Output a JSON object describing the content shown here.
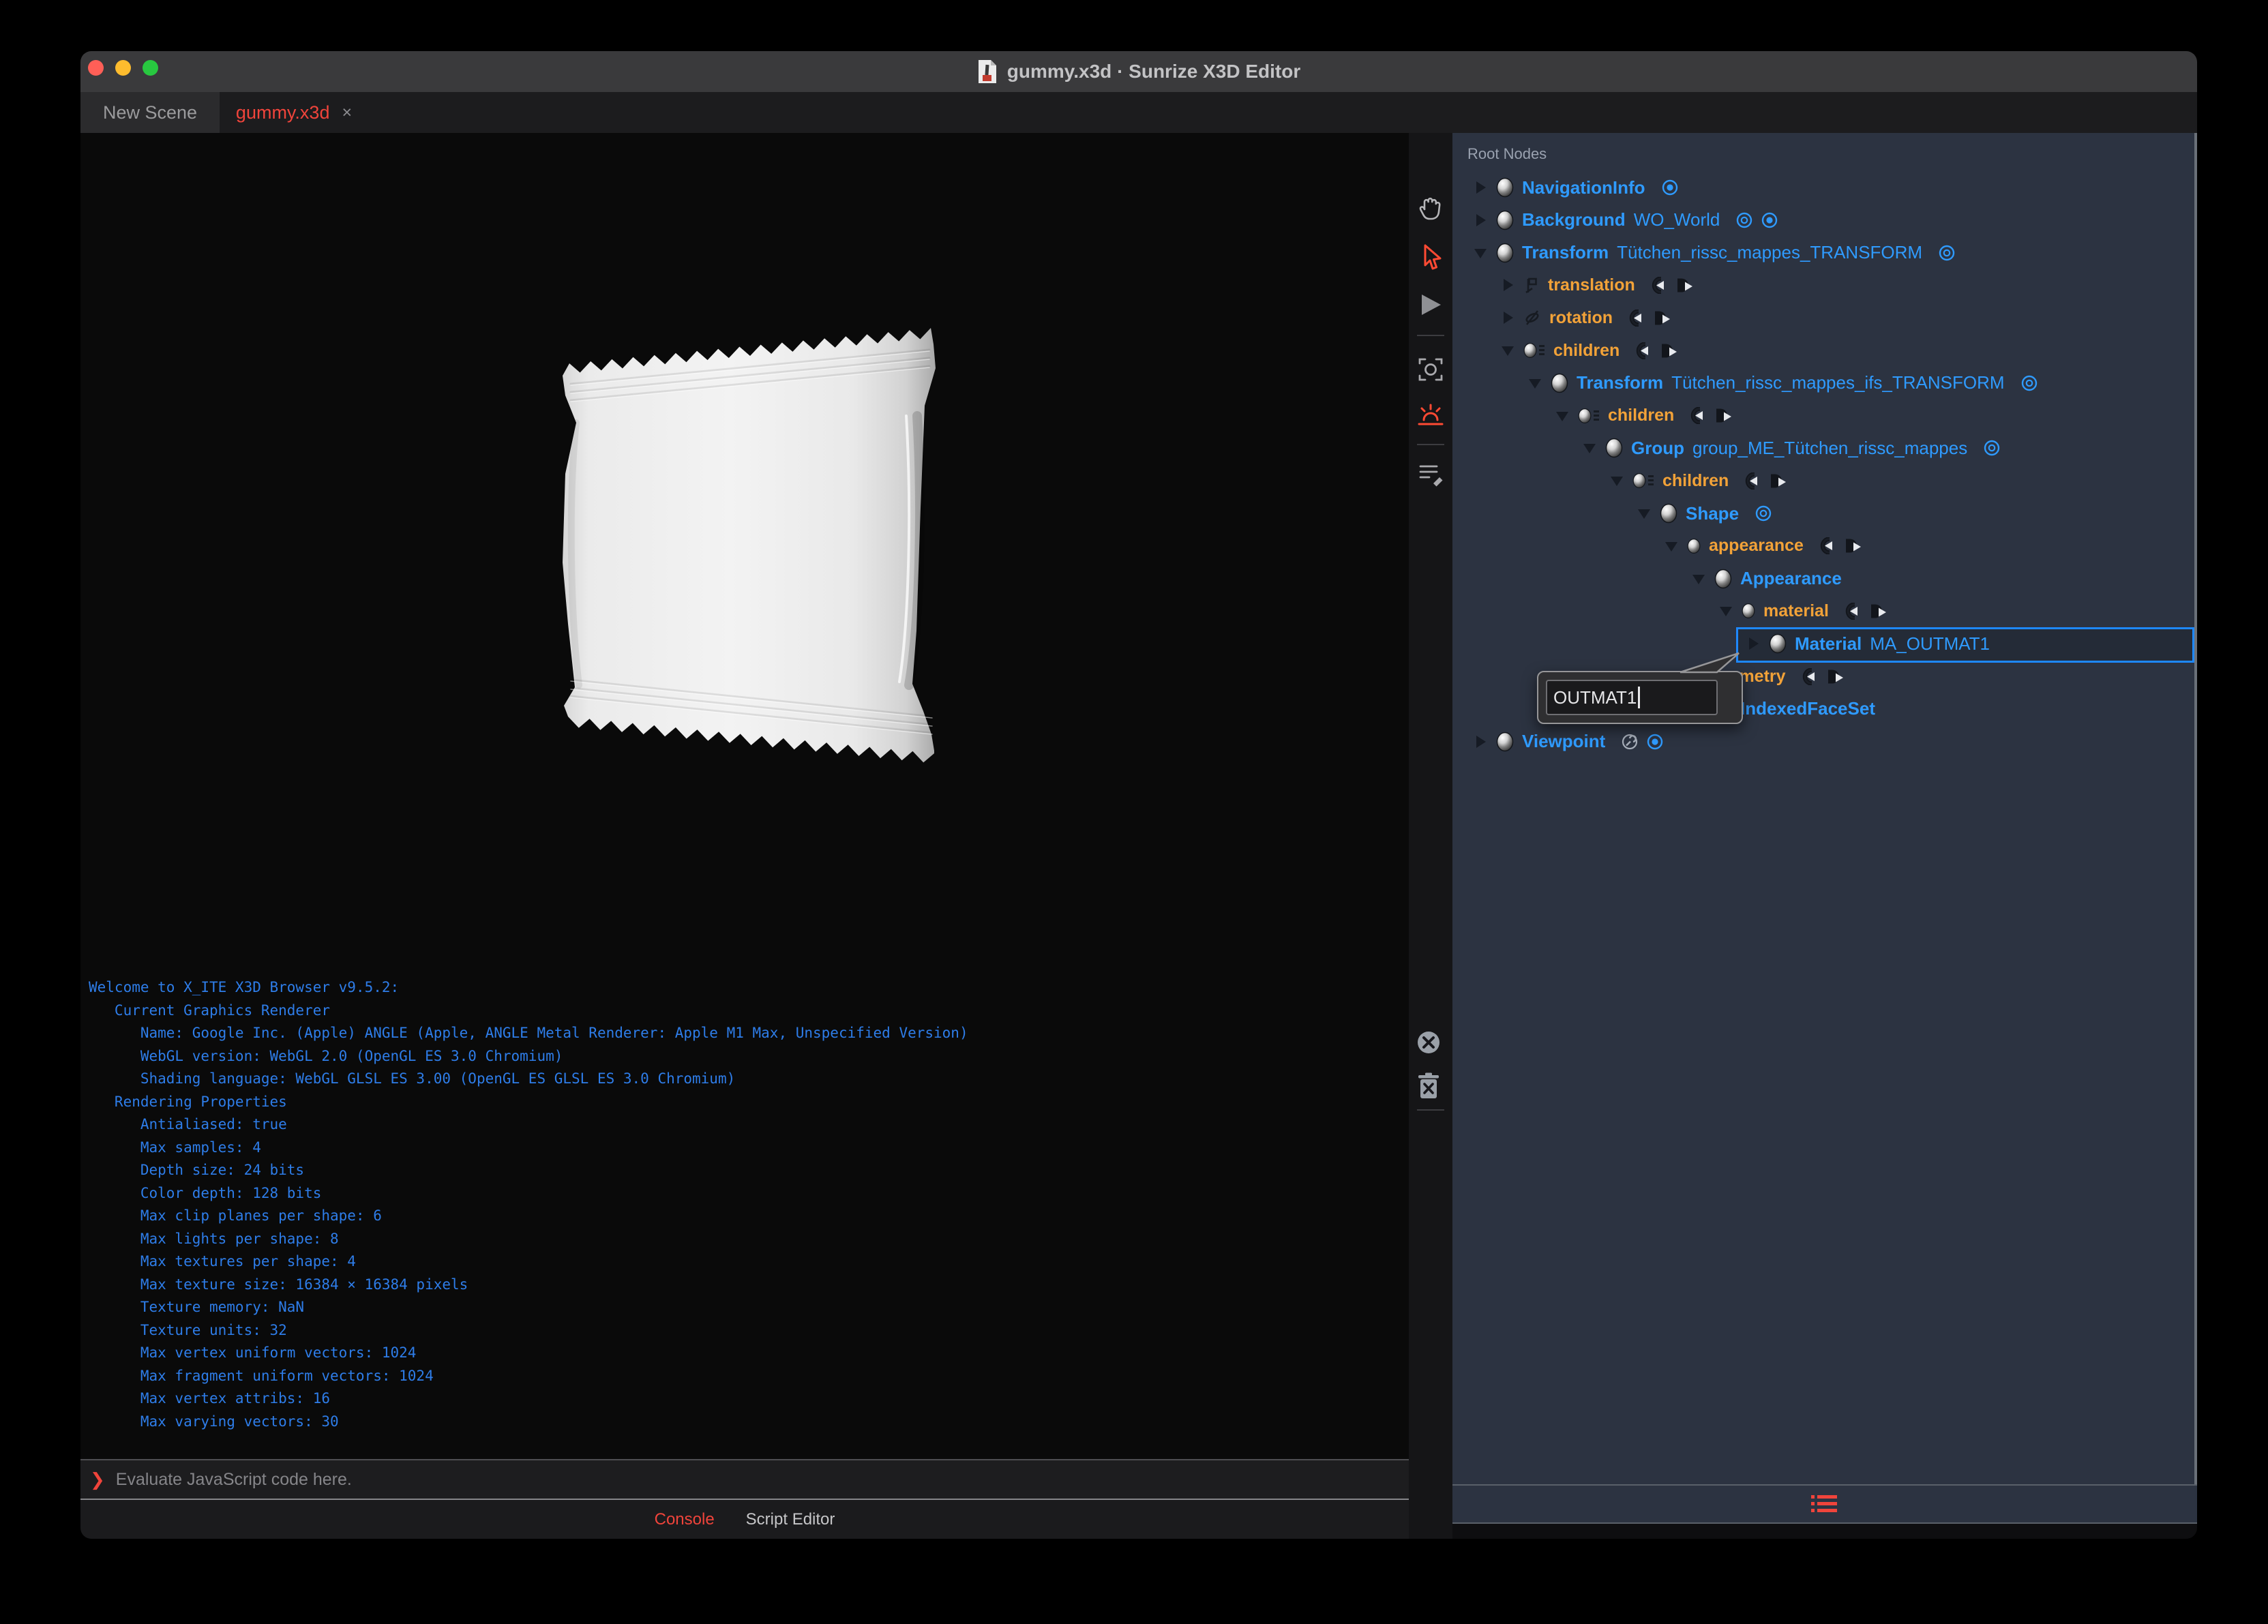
{
  "titlebar": {
    "title": "gummy.x3d · Sunrize X3D Editor"
  },
  "tabs": [
    {
      "label": "New Scene",
      "active": false
    },
    {
      "label": "gummy.x3d",
      "close_label": "×",
      "active": true
    }
  ],
  "viewport": {
    "rendered_object": "white flow-wrap packet"
  },
  "viewport_toolbar": [
    {
      "name": "pan-hand-icon",
      "active": false
    },
    {
      "name": "select-arrow-icon",
      "active": true
    },
    {
      "name": "play-icon",
      "active": false
    },
    {
      "name": "divider"
    },
    {
      "name": "snapshot-icon",
      "active": false
    },
    {
      "name": "sunrise-environment-icon",
      "active": true
    },
    {
      "name": "divider"
    },
    {
      "name": "script-edit-icon",
      "active": false
    }
  ],
  "console_side_toolbar": [
    {
      "name": "close-circle-icon"
    },
    {
      "name": "clear-console-trash-icon"
    },
    {
      "name": "divider"
    }
  ],
  "console": {
    "lines": [
      "Welcome to X_ITE X3D Browser v9.5.2:",
      "   Current Graphics Renderer",
      "      Name: Google Inc. (Apple) ANGLE (Apple, ANGLE Metal Renderer: Apple M1 Max, Unspecified Version)",
      "      WebGL version: WebGL 2.0 (OpenGL ES 3.0 Chromium)",
      "      Shading language: WebGL GLSL ES 3.00 (OpenGL ES GLSL ES 3.0 Chromium)",
      "   Rendering Properties",
      "      Antialiased: true",
      "      Max samples: 4",
      "      Depth size: 24 bits",
      "      Color depth: 128 bits",
      "      Max clip planes per shape: 6",
      "      Max lights per shape: 8",
      "      Max textures per shape: 4",
      "      Max texture size: 16384 × 16384 pixels",
      "      Texture memory: NaN",
      "      Texture units: 32",
      "      Max vertex uniform vectors: 1024",
      "      Max fragment uniform vectors: 1024",
      "      Max vertex attribs: 16",
      "      Max varying vectors: 30"
    ],
    "prompt": "❯",
    "input_placeholder": "Evaluate JavaScript code here.",
    "tabs": [
      {
        "label": "Console",
        "active": true
      },
      {
        "label": "Script Editor",
        "active": false
      }
    ]
  },
  "outline": {
    "header": "Root Nodes",
    "rows": [
      {
        "depth": 0,
        "arrow": "closed",
        "icon": "sphere",
        "type": "NavigationInfo",
        "name": "",
        "trail": [
          "bound"
        ]
      },
      {
        "depth": 0,
        "arrow": "closed",
        "icon": "sphere",
        "type": "Background",
        "name": "WO_World",
        "trail": [
          "eye",
          "bound"
        ]
      },
      {
        "depth": 0,
        "arrow": "open",
        "icon": "sphere",
        "type": "Transform",
        "name": "Tütchen_rissc_mappes_TRANSFORM",
        "trail": [
          "eye"
        ]
      },
      {
        "depth": 1,
        "arrow": "closed",
        "icon": "vec",
        "field": "translation",
        "routes": true
      },
      {
        "depth": 1,
        "arrow": "closed",
        "icon": "rot",
        "field": "rotation",
        "routes": true
      },
      {
        "depth": 1,
        "arrow": "open",
        "icon": "sphere-list",
        "field": "children",
        "routes": true
      },
      {
        "depth": 2,
        "arrow": "open",
        "icon": "sphere",
        "type": "Transform",
        "name": "Tütchen_rissc_mappes_ifs_TRANSFORM",
        "trail": [
          "eye"
        ]
      },
      {
        "depth": 3,
        "arrow": "open",
        "icon": "sphere-list",
        "field": "children",
        "routes": true
      },
      {
        "depth": 4,
        "arrow": "open",
        "icon": "sphere",
        "type": "Group",
        "name": "group_ME_Tütchen_rissc_mappes",
        "trail": [
          "eye"
        ]
      },
      {
        "depth": 5,
        "arrow": "open",
        "icon": "sphere-list",
        "field": "children",
        "routes": true
      },
      {
        "depth": 6,
        "arrow": "open",
        "icon": "sphere",
        "type": "Shape",
        "name": "",
        "trail": [
          "eye"
        ]
      },
      {
        "depth": 7,
        "arrow": "open",
        "icon": "sphere-small",
        "field": "appearance",
        "routes": true
      },
      {
        "depth": 8,
        "arrow": "open",
        "icon": "sphere",
        "type": "Appearance",
        "name": "",
        "trail": []
      },
      {
        "depth": 9,
        "arrow": "open",
        "icon": "sphere-small",
        "field": "material",
        "routes": true
      },
      {
        "depth": 10,
        "arrow": "closed",
        "icon": "sphere",
        "type": "Material",
        "name": "MA_OUTMAT1",
        "trail": [],
        "selected": true
      },
      {
        "depth": 7,
        "arrow": "open",
        "icon": "sphere-small",
        "field": "geometry",
        "routes": true
      },
      {
        "depth": 8,
        "arrow": "closed",
        "icon": "sphere",
        "type": "IndexedFaceSet",
        "name": "",
        "trail": []
      },
      {
        "depth": 0,
        "arrow": "closed",
        "icon": "sphere",
        "type": "Viewpoint",
        "name": "",
        "trail": [
          "wrench",
          "bound"
        ]
      }
    ],
    "rename_popup": {
      "value": "OUTMAT1"
    },
    "bottom_toolbar": [
      {
        "name": "outline-list-icon"
      }
    ]
  },
  "colors": {
    "node_blue": "#2f9bff",
    "field_orange": "#f2a238",
    "accent_red": "#f0443b",
    "console_blue": "#2e7de9",
    "panel_bg": "#2c3341",
    "selection_border": "#1e88ff",
    "titlebar_bg": "#3a3a3c",
    "traffic_close": "#ff5f57",
    "traffic_min": "#febc2e",
    "traffic_max": "#28c840"
  }
}
